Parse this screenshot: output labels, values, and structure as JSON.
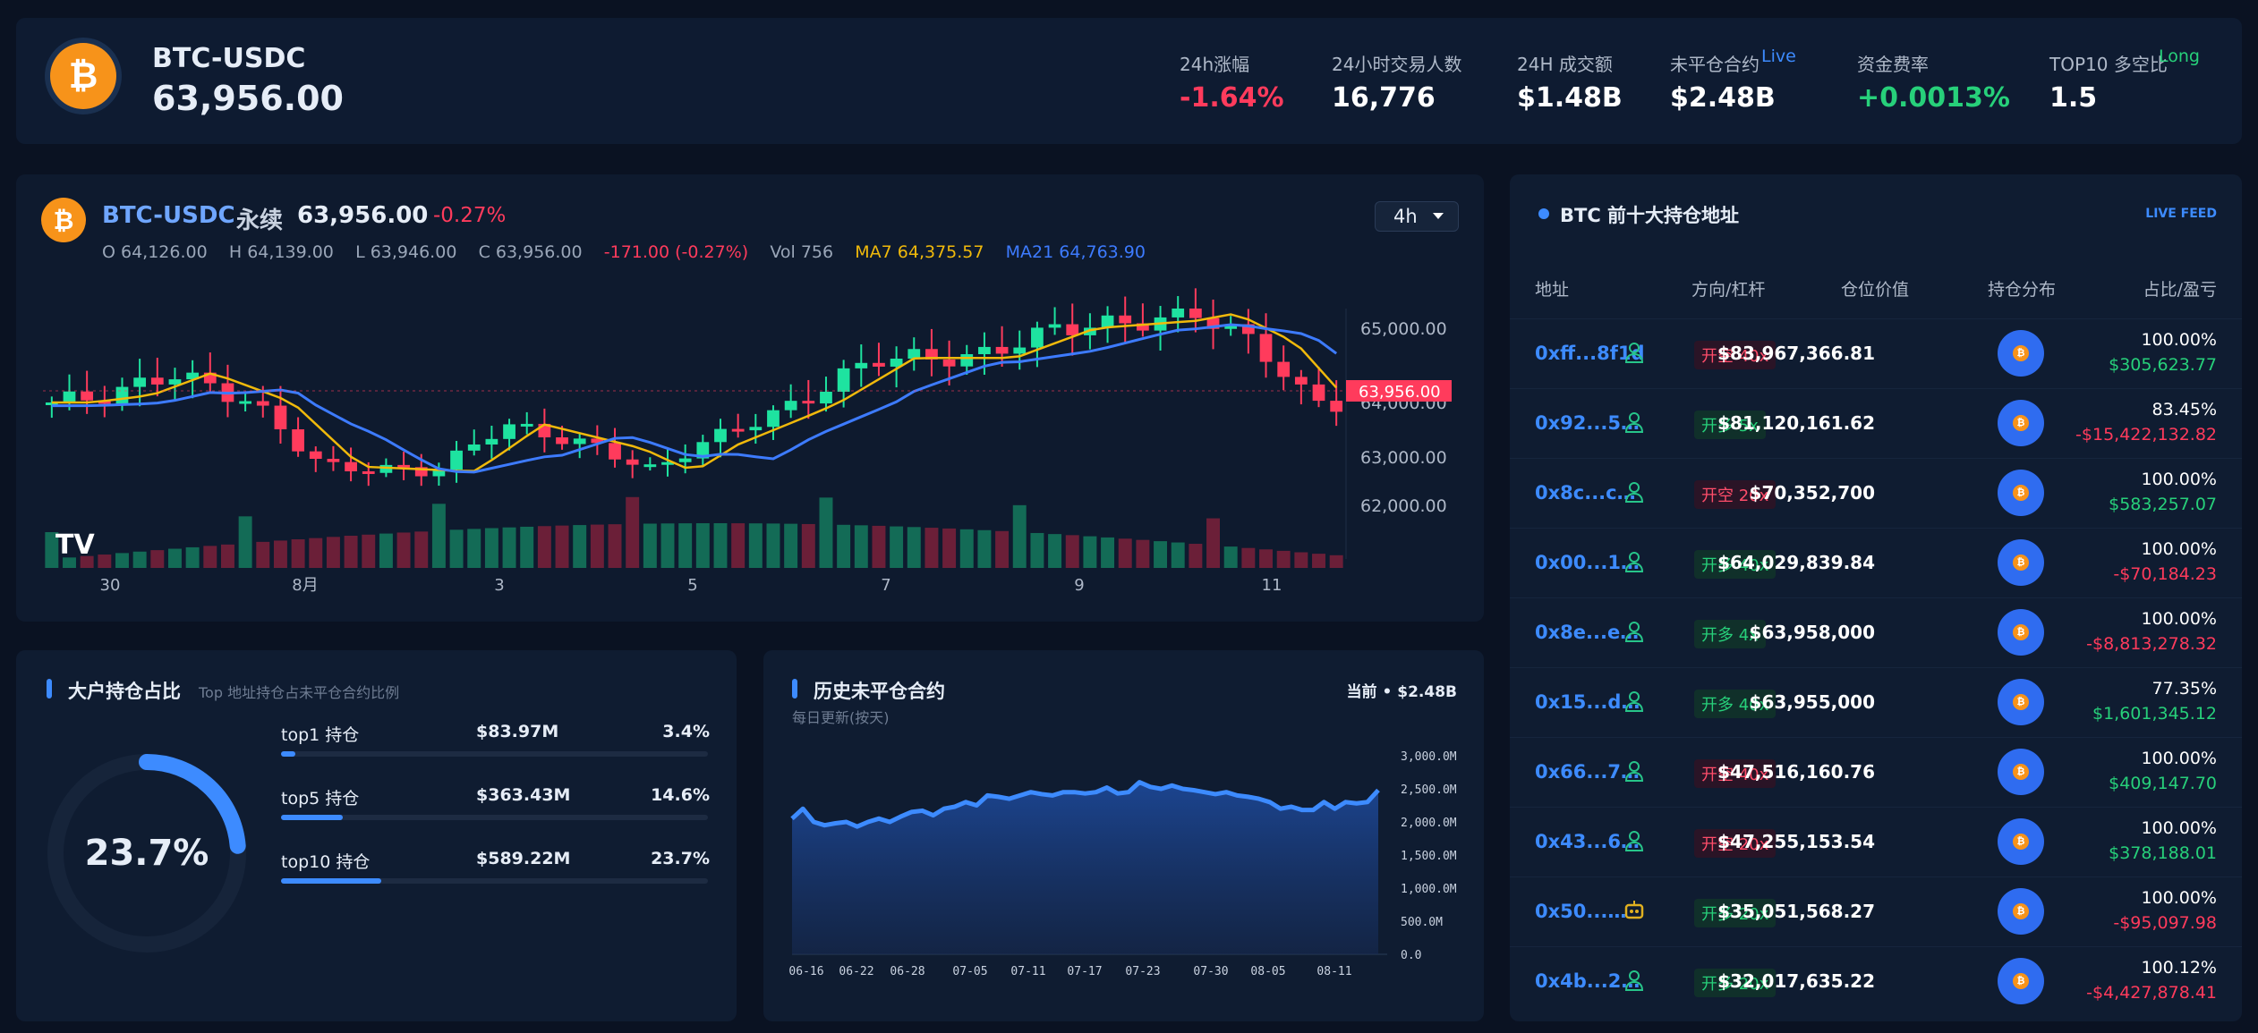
{
  "header": {
    "pair": "BTC-USDC",
    "price": "63,956.00",
    "stats": [
      {
        "label": "24h涨幅",
        "value": "-1.64%",
        "tag": ""
      },
      {
        "label": "24小时交易人数",
        "value": "16,776",
        "tag": ""
      },
      {
        "label": "24H 成交额",
        "value": "$1.48B",
        "tag": ""
      },
      {
        "label": "未平仓合约",
        "value": "$2.48B",
        "tag": "Live"
      },
      {
        "label": "资金费率",
        "value": "+0.0013%",
        "tag": ""
      },
      {
        "label": "TOP10 多空比",
        "value": "1.5",
        "tag": "Long"
      }
    ]
  },
  "chart": {
    "pair": "BTC-USDC",
    "type": "永续",
    "price": "63,956.00",
    "change": "-0.27%",
    "interval": "4h",
    "ohlc": {
      "o": "O 64,126.00",
      "h": "H 64,139.00",
      "l": "L 63,946.00",
      "c": "C 63,956.00",
      "chg": "-171.00 (-0.27%)",
      "vol": "Vol 756",
      "ma7": "MA7 64,375.57",
      "ma21": "MA21 64,763.90"
    },
    "price_tag": "63,956.00",
    "y_ticks": [
      "65,000.00",
      "64,000.00",
      "63,000.00",
      "62,000.00"
    ],
    "x_ticks": [
      "30",
      "8月",
      "3",
      "5",
      "7",
      "9",
      "11"
    ],
    "logo": "TV"
  },
  "holdings": {
    "title": "大户持仓占比",
    "subtitle": "Top 地址持仓占未平仓合约比例",
    "center": "23.7%",
    "rows": [
      {
        "label": "top1 持仓",
        "value": "$83.97M",
        "pct": "3.4%",
        "fill": 3.4
      },
      {
        "label": "top5 持仓",
        "value": "$363.43M",
        "pct": "14.6%",
        "fill": 14.6
      },
      {
        "label": "top10 持仓",
        "value": "$589.22M",
        "pct": "23.7%",
        "fill": 23.7
      }
    ],
    "ring_fill": 23.7
  },
  "open_interest": {
    "title": "历史未平仓合约",
    "subtitle": "每日更新(按天)",
    "current": "当前 • $2.48B",
    "y_ticks": [
      "3,000.0M",
      "2,500.0M",
      "2,000.0M",
      "1,500.0M",
      "1,000.0M",
      "500.0M",
      "0.0"
    ],
    "x_ticks": [
      "06-16",
      "06-22",
      "06-28",
      "07-05",
      "07-11",
      "07-17",
      "07-23",
      "07-30",
      "08-05",
      "08-11"
    ]
  },
  "top10": {
    "title": "BTC 前十大持仓地址",
    "live": "LIVE FEED",
    "headers": [
      "地址",
      "方向/杠杆",
      "仓位价值",
      "持仓分布",
      "占比/盈亏"
    ],
    "rows": [
      {
        "addr": "0xff...8f1d",
        "side": "开空 40x",
        "dir": "short",
        "value": "$83,967,366.81",
        "pct": "100.00%",
        "pnl": "$305,623.77",
        "pnl_pos": true,
        "icon": "user-icon"
      },
      {
        "addr": "0x92...5…",
        "side": "开多 5x",
        "dir": "long",
        "value": "$81,120,161.62",
        "pct": "83.45%",
        "pnl": "-$15,422,132.82",
        "pnl_pos": false,
        "icon": "user-icon"
      },
      {
        "addr": "0x8c...c…",
        "side": "开空 20x",
        "dir": "short",
        "value": "$70,352,700",
        "pct": "100.00%",
        "pnl": "$583,257.07",
        "pnl_pos": true,
        "icon": "user-icon"
      },
      {
        "addr": "0x00...1…",
        "side": "开多 40x",
        "dir": "long",
        "value": "$64,029,839.84",
        "pct": "100.00%",
        "pnl": "-$70,184.23",
        "pnl_pos": false,
        "icon": "user-icon"
      },
      {
        "addr": "0x8e...e…",
        "side": "开多 4x",
        "dir": "long",
        "value": "$63,958,000",
        "pct": "100.00%",
        "pnl": "-$8,813,278.32",
        "pnl_pos": false,
        "icon": "user-icon"
      },
      {
        "addr": "0x15...d…",
        "side": "开多 40x",
        "dir": "long",
        "value": "$63,955,000",
        "pct": "77.35%",
        "pnl": "$1,601,345.12",
        "pnl_pos": true,
        "icon": "user-icon"
      },
      {
        "addr": "0x66...7…",
        "side": "开空 40x",
        "dir": "short",
        "value": "$47,516,160.76",
        "pct": "100.00%",
        "pnl": "$409,147.70",
        "pnl_pos": true,
        "icon": "user-icon"
      },
      {
        "addr": "0x43...6…",
        "side": "开空 20x",
        "dir": "short",
        "value": "$47,255,153.54",
        "pct": "100.00%",
        "pnl": "$378,188.01",
        "pnl_pos": true,
        "icon": "user-icon"
      },
      {
        "addr": "0x50...…",
        "side": "开多 20x",
        "dir": "long",
        "value": "$35,051,568.27",
        "pct": "100.00%",
        "pnl": "-$95,097.98",
        "pnl_pos": false,
        "icon": "robot-icon"
      },
      {
        "addr": "0x4b...2…",
        "side": "开多 20x",
        "dir": "long",
        "value": "$32,017,635.22",
        "pct": "100.12%",
        "pnl": "-$4,427,878.41",
        "pnl_pos": false,
        "icon": "user-icon"
      }
    ]
  },
  "colors": {
    "accent": "#3d8bff",
    "up": "#27d07a",
    "down": "#ff3b5c",
    "btc": "#f7931a",
    "ma7": "#f0b90b",
    "ma21": "#3d7bff"
  }
}
